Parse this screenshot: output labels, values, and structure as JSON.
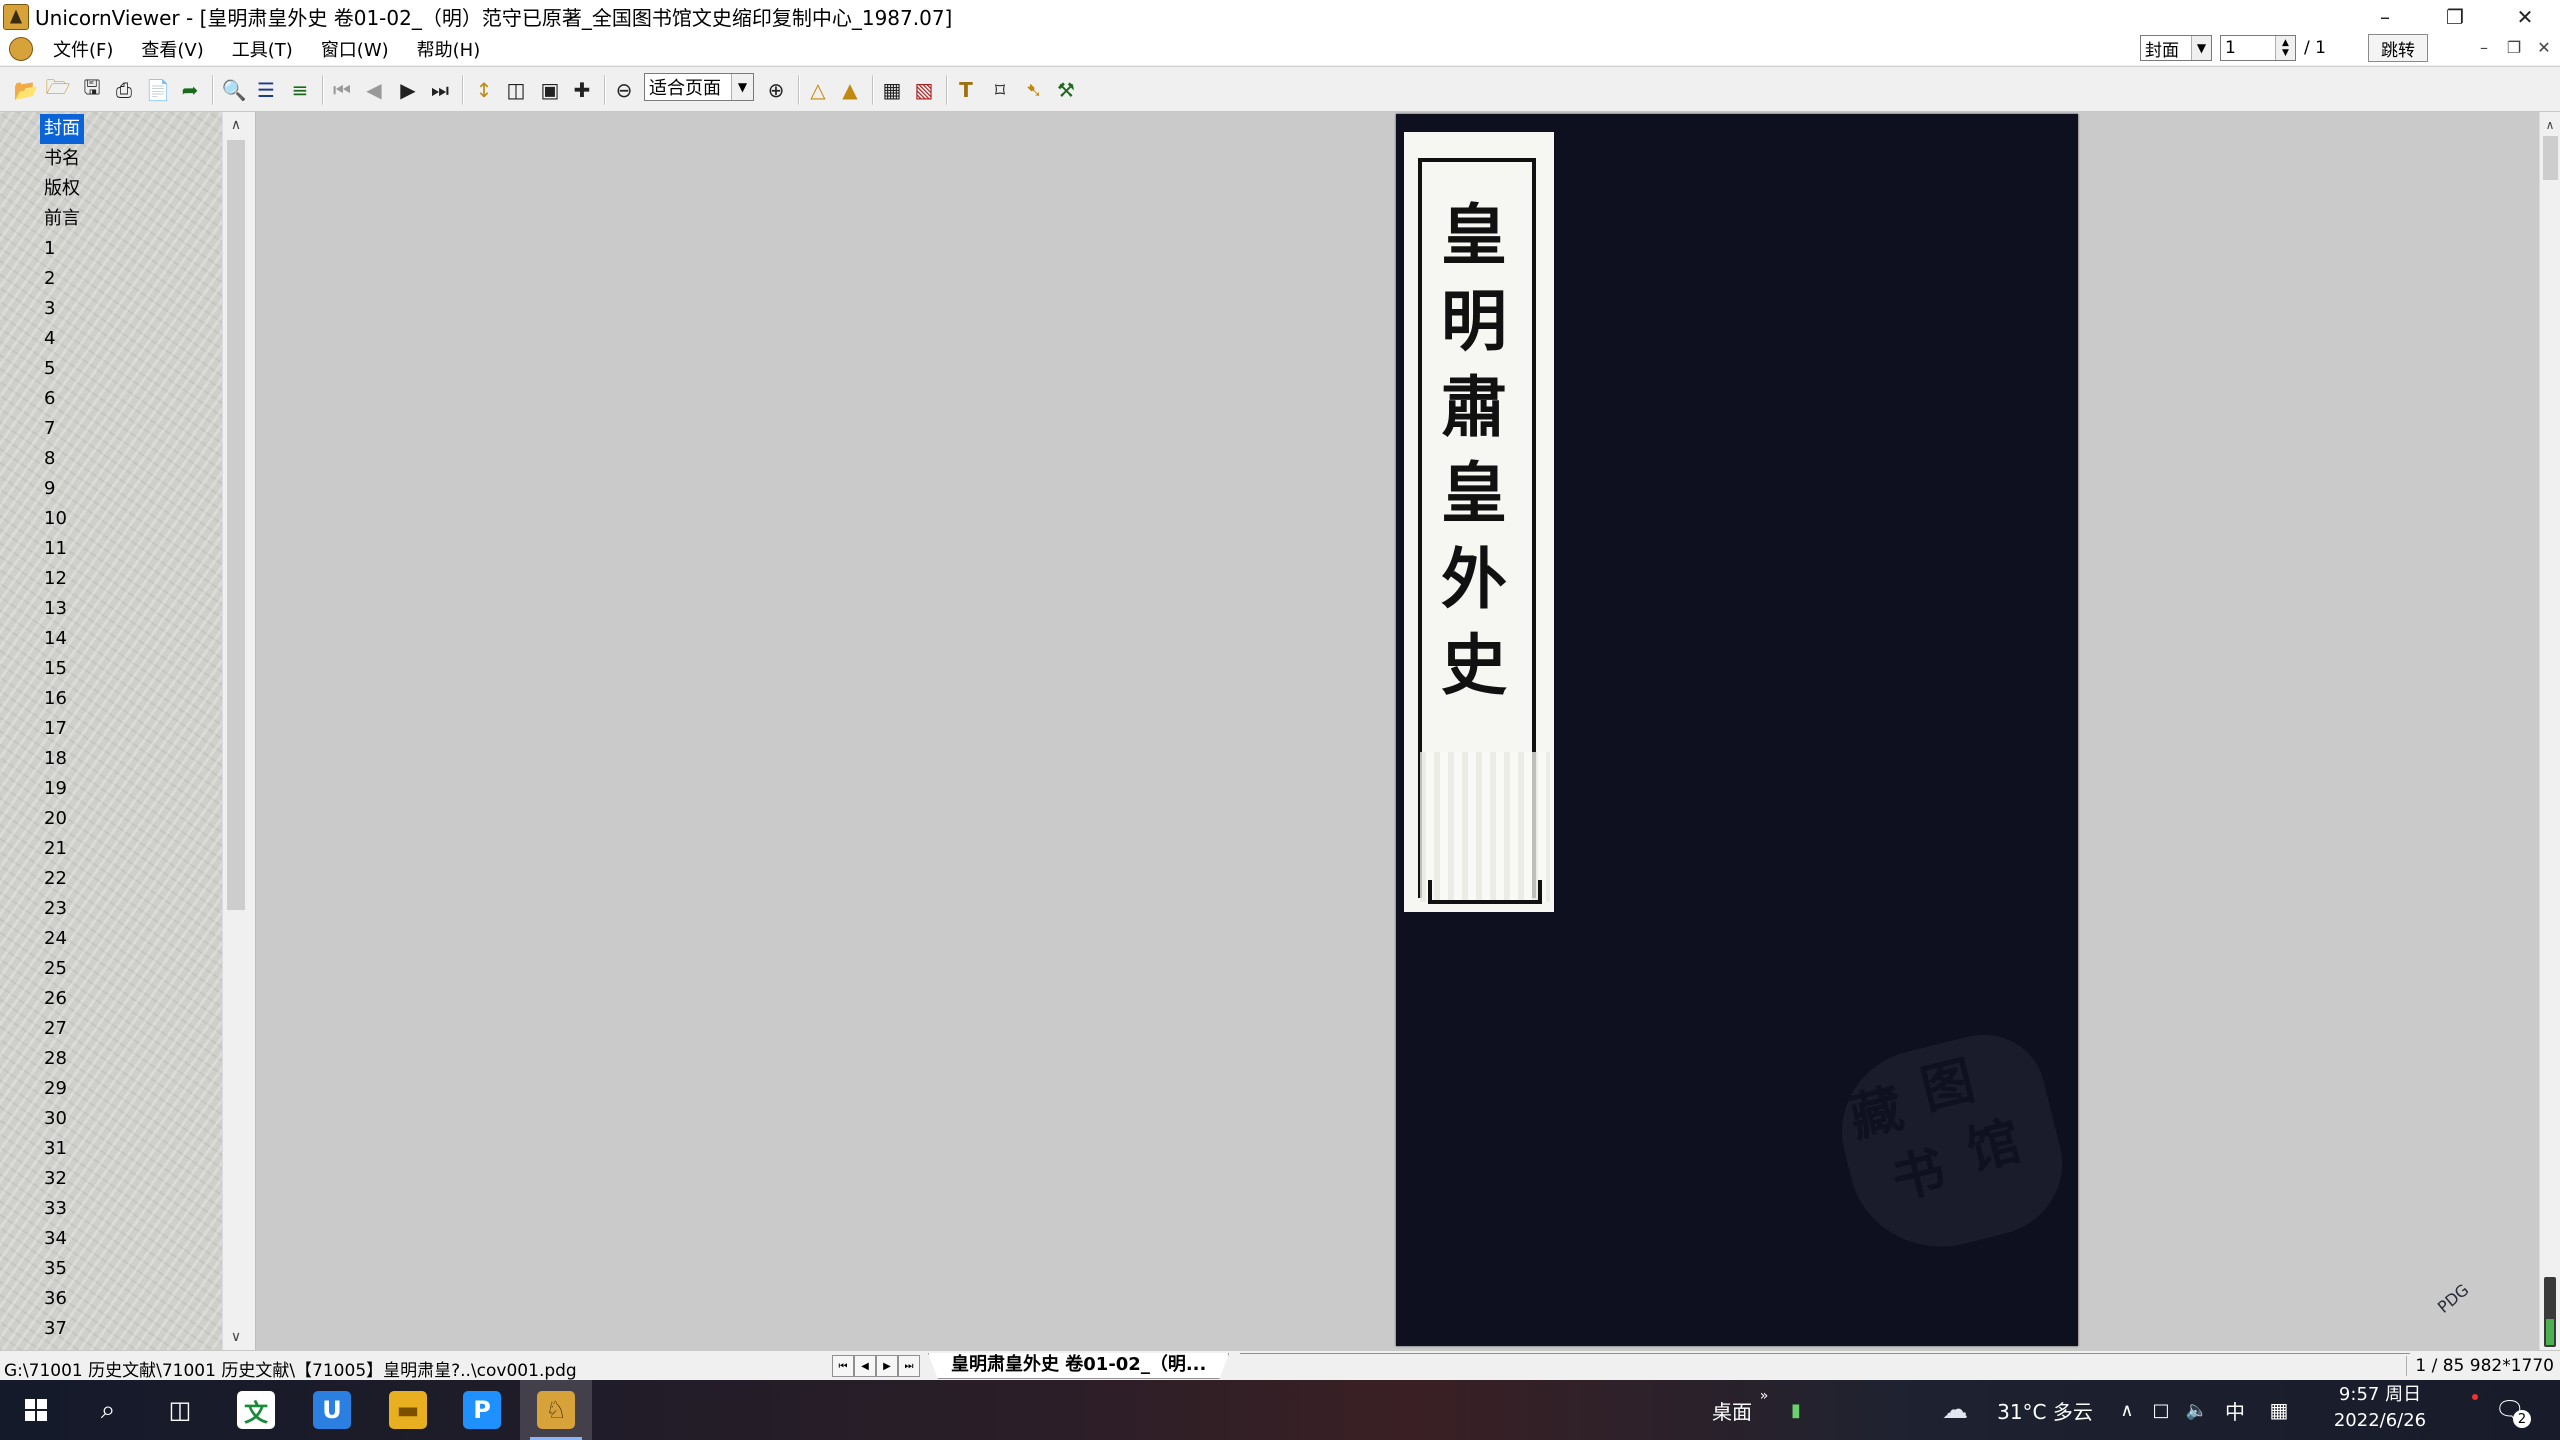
{
  "window": {
    "title": "UnicornViewer - [皇明肃皇外史  卷01-02_（明）范守已原著_全国图书馆文史缩印复制中心_1987.07]"
  },
  "menu": [
    "文件(F)",
    "查看(V)",
    "工具(T)",
    "窗口(W)",
    "帮助(H)"
  ],
  "jump": {
    "section": "封面",
    "page": "1",
    "total": "/ 1",
    "button": "跳转"
  },
  "toolbar": {
    "zoom": "适合页面",
    "icons": [
      "open-icon",
      "open-folder-icon",
      "save-icon",
      "print-icon",
      "export-icon",
      "send-icon",
      "search-icon",
      "toc-icon",
      "bookmark-icon",
      "first-page-icon",
      "prev-page-icon",
      "next-page-icon",
      "last-page-icon",
      "fit-width-icon",
      "two-page-icon",
      "single-page-icon",
      "pan-icon",
      "zoom-out-icon",
      "zoom-in-icon",
      "rotate-left-icon",
      "rotate-right-icon",
      "image-tool-icon",
      "image-adjust-icon",
      "text-select-icon",
      "crop-icon",
      "magic-select-icon",
      "settings-icon"
    ]
  },
  "sidebar": {
    "items": [
      "封面",
      "书名",
      "版权",
      "前言",
      "1",
      "2",
      "3",
      "4",
      "5",
      "6",
      "7",
      "8",
      "9",
      "10",
      "11",
      "12",
      "13",
      "14",
      "15",
      "16",
      "17",
      "18",
      "19",
      "20",
      "21",
      "22",
      "23",
      "24",
      "25",
      "26",
      "27",
      "28",
      "29",
      "30",
      "31",
      "32",
      "33",
      "34",
      "35",
      "36",
      "37"
    ],
    "selected": 0
  },
  "page_image": {
    "label_text": "皇明肅皇外史",
    "watermark": "PDG"
  },
  "status": {
    "path": "G:\\71001 历史文献\\71001 历史文献\\【71005】皇明肃皇?..\\cov001.pdg",
    "tab_label": "皇明肃皇外史  卷01-02_（明...",
    "info": "1 / 85 982*1770"
  },
  "taskbar": {
    "desktop_label": "桌面",
    "weather": "31°C 多云",
    "ime": "中",
    "clock_time": "9:57 周日",
    "clock_date": "2022/6/26",
    "notifications": "2"
  },
  "colors": {
    "selection": "#0a64d8",
    "page_bg": "#0e0f1f",
    "viewer_bg": "#cacaca"
  }
}
